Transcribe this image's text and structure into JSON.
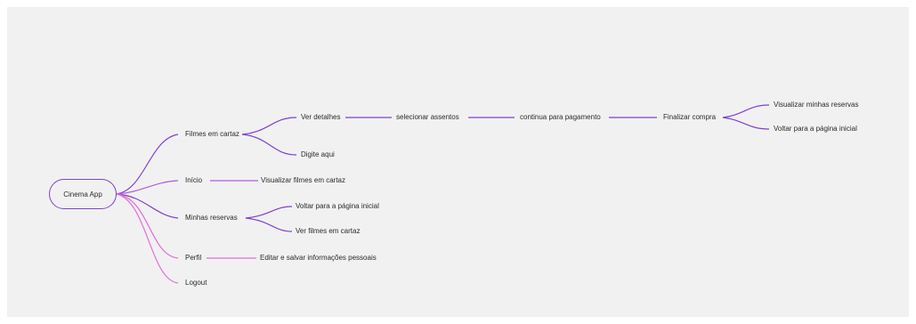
{
  "mindmap": {
    "root": "Cinema App",
    "branches": {
      "filmes": {
        "label": "Filmes em cartaz",
        "ver_detalhes": "Ver detalhes",
        "selecionar_assentos": "selecionar assentos",
        "continua_pagamento": "continua para pagamento",
        "finalizar_compra": "Finalizar compra",
        "visualizar_reservas": "Visualizar minhas reservas",
        "voltar_inicial": "Voltar para a página inicial",
        "digite_aqui": "Digite aqui"
      },
      "inicio": {
        "label": "Início",
        "visualizar_filmes": "Visualizar filmes em cartaz"
      },
      "reservas": {
        "label": "Minhas reservas",
        "voltar_inicial": "Voltar para a página inicial",
        "ver_filmes": "Ver filmes em cartaz"
      },
      "perfil": {
        "label": "Perfil",
        "editar": "Editar e salvar informações pessoais"
      },
      "logout": {
        "label": "Logout"
      }
    }
  },
  "colors": {
    "purple": "#7e40d6",
    "pink": "#e070d8",
    "background": "#f1f1f1",
    "text": "#2b2b2b"
  }
}
